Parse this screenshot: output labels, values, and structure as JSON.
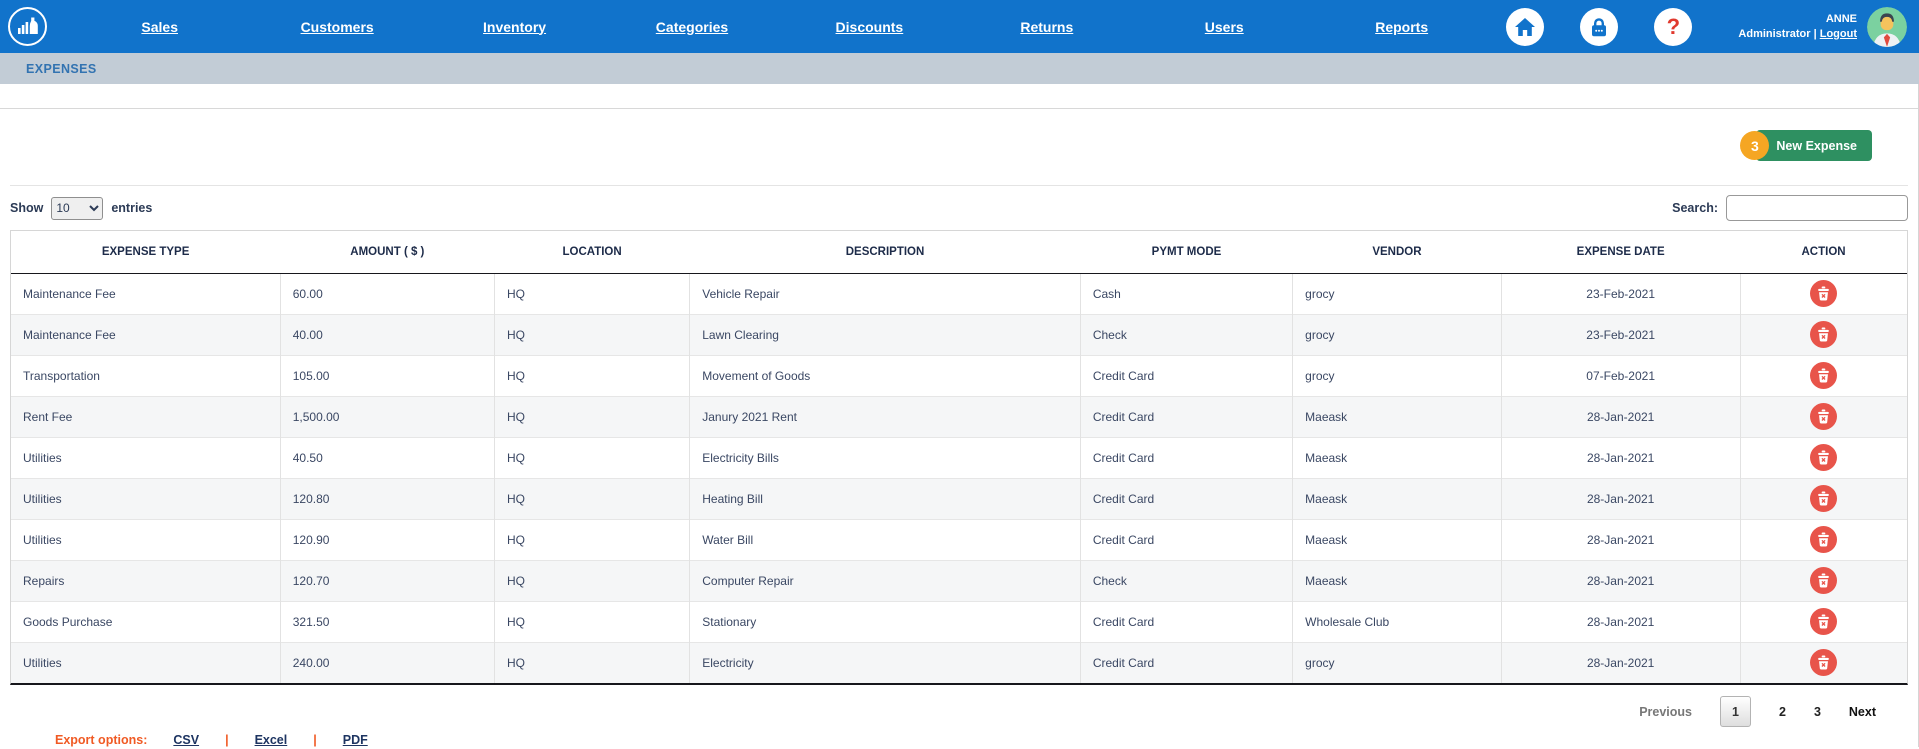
{
  "nav": {
    "items": [
      "Sales",
      "Customers",
      "Inventory",
      "Categories",
      "Discounts",
      "Returns",
      "Users",
      "Reports"
    ],
    "icons": [
      "home-icon",
      "lock-icon",
      "help-icon"
    ],
    "user": {
      "name": "ANNE",
      "role": "Administrator",
      "separator": "|",
      "logout": "Logout"
    }
  },
  "breadcrumb": "EXPENSES",
  "toolbar": {
    "badge_count": "3",
    "new_expense_label": "New Expense"
  },
  "table_controls": {
    "show_label": "Show",
    "page_size": "10",
    "entries_label": "entries",
    "search_label": "Search:",
    "search_value": ""
  },
  "table": {
    "columns": [
      "EXPENSE TYPE",
      "AMOUNT ( $ )",
      "LOCATION",
      "DESCRIPTION",
      "PYMT MODE",
      "VENDOR",
      "EXPENSE DATE",
      "ACTION"
    ],
    "rows": [
      {
        "expense_type": "Maintenance Fee",
        "amount": "60.00",
        "location": "HQ",
        "description": "Vehicle Repair",
        "pymt_mode": "Cash",
        "vendor": "grocy",
        "expense_date": "23-Feb-2021"
      },
      {
        "expense_type": "Maintenance Fee",
        "amount": "40.00",
        "location": "HQ",
        "description": "Lawn Clearing",
        "pymt_mode": "Check",
        "vendor": "grocy",
        "expense_date": "23-Feb-2021"
      },
      {
        "expense_type": "Transportation",
        "amount": "105.00",
        "location": "HQ",
        "description": "Movement of Goods",
        "pymt_mode": "Credit Card",
        "vendor": "grocy",
        "expense_date": "07-Feb-2021"
      },
      {
        "expense_type": "Rent Fee",
        "amount": "1,500.00",
        "location": "HQ",
        "description": "Janury 2021 Rent",
        "pymt_mode": "Credit Card",
        "vendor": "Maeask",
        "expense_date": "28-Jan-2021"
      },
      {
        "expense_type": "Utilities",
        "amount": "40.50",
        "location": "HQ",
        "description": "Electricity Bills",
        "pymt_mode": "Credit Card",
        "vendor": "Maeask",
        "expense_date": "28-Jan-2021"
      },
      {
        "expense_type": "Utilities",
        "amount": "120.80",
        "location": "HQ",
        "description": "Heating Bill",
        "pymt_mode": "Credit Card",
        "vendor": "Maeask",
        "expense_date": "28-Jan-2021"
      },
      {
        "expense_type": "Utilities",
        "amount": "120.90",
        "location": "HQ",
        "description": "Water Bill",
        "pymt_mode": "Credit Card",
        "vendor": "Maeask",
        "expense_date": "28-Jan-2021"
      },
      {
        "expense_type": "Repairs",
        "amount": "120.70",
        "location": "HQ",
        "description": "Computer Repair",
        "pymt_mode": "Check",
        "vendor": "Maeask",
        "expense_date": "28-Jan-2021"
      },
      {
        "expense_type": "Goods Purchase",
        "amount": "321.50",
        "location": "HQ",
        "description": "Stationary",
        "pymt_mode": "Credit Card",
        "vendor": "Wholesale Club",
        "expense_date": "28-Jan-2021"
      },
      {
        "expense_type": "Utilities",
        "amount": "240.00",
        "location": "HQ",
        "description": "Electricity",
        "pymt_mode": "Credit Card",
        "vendor": "grocy",
        "expense_date": "28-Jan-2021"
      }
    ]
  },
  "pagination": {
    "previous_label": "Previous",
    "pages": [
      "1",
      "2",
      "3"
    ],
    "current_page": "1",
    "next_label": "Next"
  },
  "export": {
    "label": "Export options:",
    "separator": "|",
    "options": [
      "CSV",
      "Excel",
      "PDF"
    ]
  },
  "colors": {
    "nav_blue": "#1173cb",
    "breadcrumb_bg": "#c2ccd6",
    "breadcrumb_text": "#3273b1",
    "green": "#2e9061",
    "badge_orange": "#f5a623",
    "delete_red": "#e8544a",
    "export_orange": "#f05a24",
    "link_navy": "#1d3461",
    "header_text": "#1d2b49",
    "cell_text": "#3a4763"
  }
}
